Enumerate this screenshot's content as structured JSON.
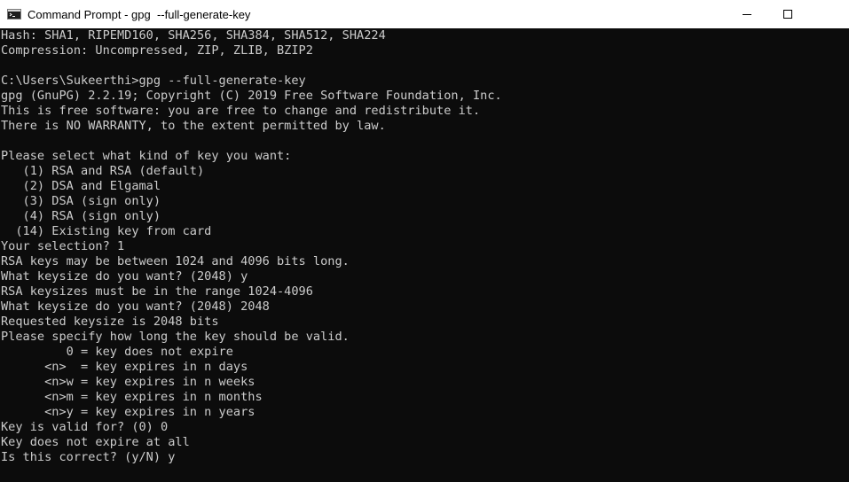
{
  "window": {
    "title": "Command Prompt - gpg  --full-generate-key",
    "icon": "cmd-icon",
    "controls": [
      "minimize-icon",
      "maximize-icon"
    ]
  },
  "colors": {
    "console_bg": "#0c0c0c",
    "console_fg": "#cccccc",
    "titlebar_bg": "#ffffff"
  },
  "console": {
    "lines": [
      "Hash: SHA1, RIPEMD160, SHA256, SHA384, SHA512, SHA224",
      "Compression: Uncompressed, ZIP, ZLIB, BZIP2",
      "",
      "C:\\Users\\Sukeerthi>gpg --full-generate-key",
      "gpg (GnuPG) 2.2.19; Copyright (C) 2019 Free Software Foundation, Inc.",
      "This is free software: you are free to change and redistribute it.",
      "There is NO WARRANTY, to the extent permitted by law.",
      "",
      "Please select what kind of key you want:",
      "   (1) RSA and RSA (default)",
      "   (2) DSA and Elgamal",
      "   (3) DSA (sign only)",
      "   (4) RSA (sign only)",
      "  (14) Existing key from card",
      "Your selection? 1",
      "RSA keys may be between 1024 and 4096 bits long.",
      "What keysize do you want? (2048) y",
      "RSA keysizes must be in the range 1024-4096",
      "What keysize do you want? (2048) 2048",
      "Requested keysize is 2048 bits",
      "Please specify how long the key should be valid.",
      "         0 = key does not expire",
      "      <n>  = key expires in n days",
      "      <n>w = key expires in n weeks",
      "      <n>m = key expires in n months",
      "      <n>y = key expires in n years",
      "Key is valid for? (0) 0",
      "Key does not expire at all",
      "Is this correct? (y/N) y"
    ]
  }
}
